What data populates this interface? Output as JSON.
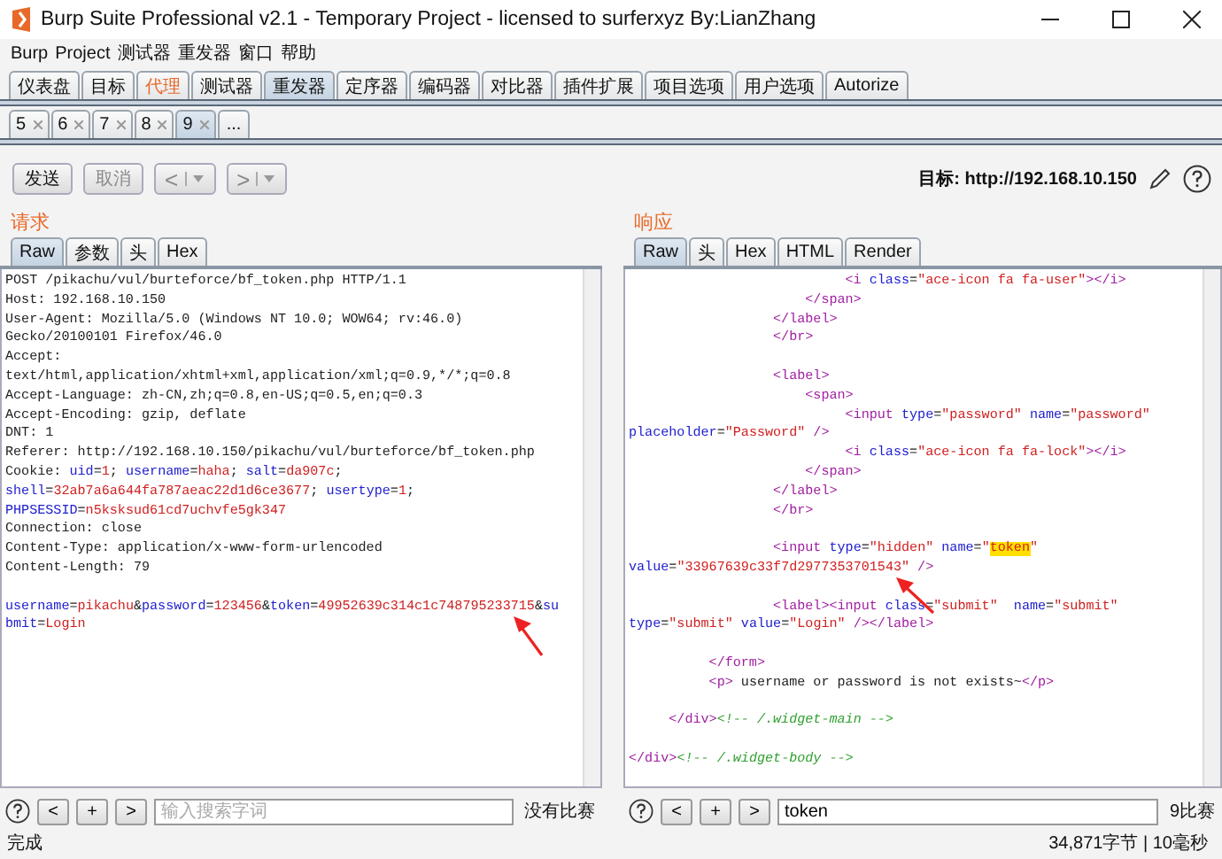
{
  "window": {
    "title": "Burp Suite Professional v2.1 - Temporary Project - licensed to surferxyz By:LianZhang"
  },
  "menu": [
    "Burp",
    "Project",
    "测试器",
    "重发器",
    "窗口",
    "帮助"
  ],
  "main_tabs": [
    {
      "label": "仪表盘",
      "selected": false,
      "alert": false
    },
    {
      "label": "目标",
      "selected": false,
      "alert": false
    },
    {
      "label": "代理",
      "selected": false,
      "alert": true
    },
    {
      "label": "测试器",
      "selected": false,
      "alert": false
    },
    {
      "label": "重发器",
      "selected": true,
      "alert": false
    },
    {
      "label": "定序器",
      "selected": false,
      "alert": false
    },
    {
      "label": "编码器",
      "selected": false,
      "alert": false
    },
    {
      "label": "对比器",
      "selected": false,
      "alert": false
    },
    {
      "label": "插件扩展",
      "selected": false,
      "alert": false
    },
    {
      "label": "项目选项",
      "selected": false,
      "alert": false
    },
    {
      "label": "用户选项",
      "selected": false,
      "alert": false
    },
    {
      "label": "Autorize",
      "selected": false,
      "alert": false
    }
  ],
  "repeater_tabs": [
    {
      "label": "5",
      "selected": false
    },
    {
      "label": "6",
      "selected": false
    },
    {
      "label": "7",
      "selected": false
    },
    {
      "label": "8",
      "selected": false
    },
    {
      "label": "9",
      "selected": true
    }
  ],
  "more_tab": "...",
  "toolbar": {
    "send": {
      "label": "发送",
      "disabled": false
    },
    "cancel": {
      "label": "取消",
      "disabled": true
    },
    "back": {
      "label": "<",
      "disabled": true
    },
    "forward": {
      "label": ">",
      "disabled": true
    },
    "target": "目标: http://192.168.10.150"
  },
  "panes": [
    {
      "title": "请求",
      "tabs": [
        {
          "label": "Raw",
          "selected": true
        },
        {
          "label": "参数",
          "selected": false
        },
        {
          "label": "头",
          "selected": false
        },
        {
          "label": "Hex",
          "selected": false
        }
      ],
      "lines": [
        {
          "kind": "code",
          "segments": [
            {
              "text": "POST /pikachu/vul/burteforce/bf_token.php HTTP/1.1",
              "kind": "plain"
            }
          ]
        },
        {
          "kind": "code",
          "segments": [
            {
              "text": "Host: 192.168.10.150",
              "kind": "plain"
            }
          ]
        },
        {
          "kind": "code",
          "segments": [
            {
              "text": "User-Agent: Mozilla/5.0 (Windows NT 10.0; WOW64; rv:46.0)",
              "kind": "plain"
            }
          ]
        },
        {
          "kind": "code",
          "segments": [
            {
              "text": "Gecko/20100101 Firefox/46.0",
              "kind": "plain"
            }
          ]
        },
        {
          "kind": "code",
          "segments": [
            {
              "text": "Accept:",
              "kind": "plain"
            }
          ]
        },
        {
          "kind": "code",
          "segments": [
            {
              "text": "text/html,application/xhtml+xml,application/xml;q=0.9,*/*;q=0.8",
              "kind": "plain"
            }
          ]
        },
        {
          "kind": "code",
          "segments": [
            {
              "text": "Accept-Language: zh-CN,zh;q=0.8,en-US;q=0.5,en;q=0.3",
              "kind": "plain"
            }
          ]
        },
        {
          "kind": "code",
          "segments": [
            {
              "text": "Accept-Encoding: gzip, deflate",
              "kind": "plain"
            }
          ]
        },
        {
          "kind": "code",
          "segments": [
            {
              "text": "DNT: 1",
              "kind": "plain"
            }
          ]
        },
        {
          "kind": "code",
          "segments": [
            {
              "text": "Referer: http://192.168.10.150/pikachu/vul/burteforce/bf_token.php",
              "kind": "plain"
            }
          ]
        },
        {
          "kind": "code",
          "segments": [
            {
              "text": "Cookie: ",
              "kind": "plain"
            },
            {
              "text": "uid",
              "kind": "name"
            },
            {
              "text": "=",
              "kind": "plain"
            },
            {
              "text": "1",
              "kind": "value"
            },
            {
              "text": "; ",
              "kind": "plain"
            },
            {
              "text": "username",
              "kind": "name"
            },
            {
              "text": "=",
              "kind": "plain"
            },
            {
              "text": "haha",
              "kind": "value"
            },
            {
              "text": "; ",
              "kind": "plain"
            },
            {
              "text": "salt",
              "kind": "name"
            },
            {
              "text": "=",
              "kind": "plain"
            },
            {
              "text": "da907c",
              "kind": "value"
            },
            {
              "text": ";",
              "kind": "plain"
            }
          ]
        },
        {
          "kind": "code",
          "segments": [
            {
              "text": "shell",
              "kind": "name"
            },
            {
              "text": "=",
              "kind": "plain"
            },
            {
              "text": "32ab7a6a644fa787aeac22d1d6ce3677",
              "kind": "value"
            },
            {
              "text": "; ",
              "kind": "plain"
            },
            {
              "text": "usertype",
              "kind": "name"
            },
            {
              "text": "=",
              "kind": "plain"
            },
            {
              "text": "1",
              "kind": "value"
            },
            {
              "text": ";",
              "kind": "plain"
            }
          ]
        },
        {
          "kind": "code",
          "segments": [
            {
              "text": "PHPSESSID",
              "kind": "name"
            },
            {
              "text": "=",
              "kind": "plain"
            },
            {
              "text": "n5ksksud61cd7uchvfe5gk347",
              "kind": "value"
            }
          ]
        },
        {
          "kind": "code",
          "segments": [
            {
              "text": "Connection: close",
              "kind": "plain"
            }
          ]
        },
        {
          "kind": "code",
          "segments": [
            {
              "text": "Content-Type: application/x-www-form-urlencoded",
              "kind": "plain"
            }
          ]
        },
        {
          "kind": "code",
          "segments": [
            {
              "text": "Content-Length: 79",
              "kind": "plain"
            }
          ]
        },
        {
          "kind": "blank"
        },
        {
          "kind": "code",
          "segments": [
            {
              "text": "username",
              "kind": "name"
            },
            {
              "text": "=",
              "kind": "plain"
            },
            {
              "text": "pikachu",
              "kind": "value"
            },
            {
              "text": "&",
              "kind": "plain"
            },
            {
              "text": "password",
              "kind": "name"
            },
            {
              "text": "=",
              "kind": "plain"
            },
            {
              "text": "123456",
              "kind": "value"
            },
            {
              "text": "&",
              "kind": "plain"
            },
            {
              "text": "token",
              "kind": "name"
            },
            {
              "text": "=",
              "kind": "plain"
            },
            {
              "text": "49952639c314c1c748795233715",
              "kind": "value"
            },
            {
              "text": "&",
              "kind": "plain"
            },
            {
              "text": "su",
              "kind": "name"
            }
          ]
        },
        {
          "kind": "code",
          "segments": [
            {
              "text": "bmit",
              "kind": "name"
            },
            {
              "text": "=",
              "kind": "plain"
            },
            {
              "text": "Login",
              "kind": "value"
            }
          ]
        }
      ],
      "search": {
        "placeholder": "输入搜索字词",
        "prev": "<",
        "add": "+",
        "next": ">",
        "result": "没有比赛"
      }
    },
    {
      "title": "响应",
      "tabs": [
        {
          "label": "Raw",
          "selected": true
        },
        {
          "label": "头",
          "selected": false
        },
        {
          "label": "Hex",
          "selected": false
        },
        {
          "label": "HTML",
          "selected": false
        },
        {
          "label": "Render",
          "selected": false
        }
      ],
      "lines": [
        {
          "kind": "code",
          "segments": [
            {
              "text": "                           <i",
              "kind": "tag"
            },
            {
              "text": " class",
              "kind": "attr"
            },
            {
              "text": "=",
              "kind": "plain"
            },
            {
              "text": "\"ace-icon fa fa-user\"",
              "kind": "string"
            },
            {
              "text": "></i>",
              "kind": "tag"
            }
          ]
        },
        {
          "kind": "code",
          "segments": [
            {
              "text": "                      </span>",
              "kind": "tag"
            }
          ]
        },
        {
          "kind": "code",
          "segments": [
            {
              "text": "                  </label>",
              "kind": "tag"
            }
          ]
        },
        {
          "kind": "code",
          "segments": [
            {
              "text": "                  </br>",
              "kind": "tag"
            }
          ]
        },
        {
          "kind": "blank"
        },
        {
          "kind": "code",
          "segments": [
            {
              "text": "                  <label>",
              "kind": "tag"
            }
          ]
        },
        {
          "kind": "code",
          "segments": [
            {
              "text": "                      <span>",
              "kind": "tag"
            }
          ]
        },
        {
          "kind": "code",
          "segments": [
            {
              "text": "                           <input",
              "kind": "tag"
            },
            {
              "text": " type",
              "kind": "attr"
            },
            {
              "text": "=",
              "kind": "plain"
            },
            {
              "text": "\"password\"",
              "kind": "string"
            },
            {
              "text": " name",
              "kind": "attr"
            },
            {
              "text": "=",
              "kind": "plain"
            },
            {
              "text": "\"password\"",
              "kind": "string"
            }
          ]
        },
        {
          "kind": "code",
          "segments": [
            {
              "text": "placeholder",
              "kind": "attr"
            },
            {
              "text": "=",
              "kind": "plain"
            },
            {
              "text": "\"Password\"",
              "kind": "string"
            },
            {
              "text": " />",
              "kind": "tag"
            }
          ]
        },
        {
          "kind": "code",
          "segments": [
            {
              "text": "                           <i",
              "kind": "tag"
            },
            {
              "text": " class",
              "kind": "attr"
            },
            {
              "text": "=",
              "kind": "plain"
            },
            {
              "text": "\"ace-icon fa fa-lock\"",
              "kind": "string"
            },
            {
              "text": "></i>",
              "kind": "tag"
            }
          ]
        },
        {
          "kind": "code",
          "segments": [
            {
              "text": "                      </span>",
              "kind": "tag"
            }
          ]
        },
        {
          "kind": "code",
          "segments": [
            {
              "text": "                  </label>",
              "kind": "tag"
            }
          ]
        },
        {
          "kind": "code",
          "segments": [
            {
              "text": "                  </br>",
              "kind": "tag"
            }
          ]
        },
        {
          "kind": "blank"
        },
        {
          "kind": "code",
          "segments": [
            {
              "text": "                  <input",
              "kind": "tag"
            },
            {
              "text": " type",
              "kind": "attr"
            },
            {
              "text": "=",
              "kind": "plain"
            },
            {
              "text": "\"hidden\"",
              "kind": "string"
            },
            {
              "text": " name",
              "kind": "attr"
            },
            {
              "text": "=",
              "kind": "plain"
            },
            {
              "text": "\"",
              "kind": "string"
            },
            {
              "text": "token",
              "kind": "match"
            },
            {
              "text": "\"",
              "kind": "string"
            }
          ]
        },
        {
          "kind": "code",
          "segments": [
            {
              "text": "value",
              "kind": "attr"
            },
            {
              "text": "=",
              "kind": "plain"
            },
            {
              "text": "\"33967639c33f7d2977353701543\"",
              "kind": "string"
            },
            {
              "text": " />",
              "kind": "tag"
            }
          ]
        },
        {
          "kind": "blank"
        },
        {
          "kind": "code",
          "segments": [
            {
              "text": "                  <label><input",
              "kind": "tag"
            },
            {
              "text": " class",
              "kind": "attr"
            },
            {
              "text": "=",
              "kind": "plain"
            },
            {
              "text": "\"submit\"",
              "kind": "string"
            },
            {
              "text": "  name",
              "kind": "attr"
            },
            {
              "text": "=",
              "kind": "plain"
            },
            {
              "text": "\"submit\"",
              "kind": "string"
            }
          ]
        },
        {
          "kind": "code",
          "segments": [
            {
              "text": "type",
              "kind": "attr"
            },
            {
              "text": "=",
              "kind": "plain"
            },
            {
              "text": "\"submit\"",
              "kind": "string"
            },
            {
              "text": " value",
              "kind": "attr"
            },
            {
              "text": "=",
              "kind": "plain"
            },
            {
              "text": "\"Login\"",
              "kind": "string"
            },
            {
              "text": " /></label>",
              "kind": "tag"
            }
          ]
        },
        {
          "kind": "blank"
        },
        {
          "kind": "code",
          "segments": [
            {
              "text": "          </form>",
              "kind": "tag"
            }
          ]
        },
        {
          "kind": "code",
          "segments": [
            {
              "text": "          <p>",
              "kind": "tag"
            },
            {
              "text": " username or password is not exists~",
              "kind": "plain"
            },
            {
              "text": "</p>",
              "kind": "tag"
            }
          ]
        },
        {
          "kind": "blank"
        },
        {
          "kind": "code",
          "segments": [
            {
              "text": "     </div>",
              "kind": "tag"
            },
            {
              "text": "<!-- /.widget-main -->",
              "kind": "comment"
            }
          ]
        },
        {
          "kind": "blank"
        },
        {
          "kind": "code",
          "segments": [
            {
              "text": "</div>",
              "kind": "tag"
            },
            {
              "text": "<!-- /.widget-body -->",
              "kind": "comment"
            }
          ]
        }
      ],
      "search": {
        "value": "token",
        "prev": "<",
        "add": "+",
        "next": ">",
        "result": "9比赛"
      }
    }
  ],
  "status_bar": {
    "left": "完成",
    "right": "34,871字节 | 10毫秒"
  }
}
